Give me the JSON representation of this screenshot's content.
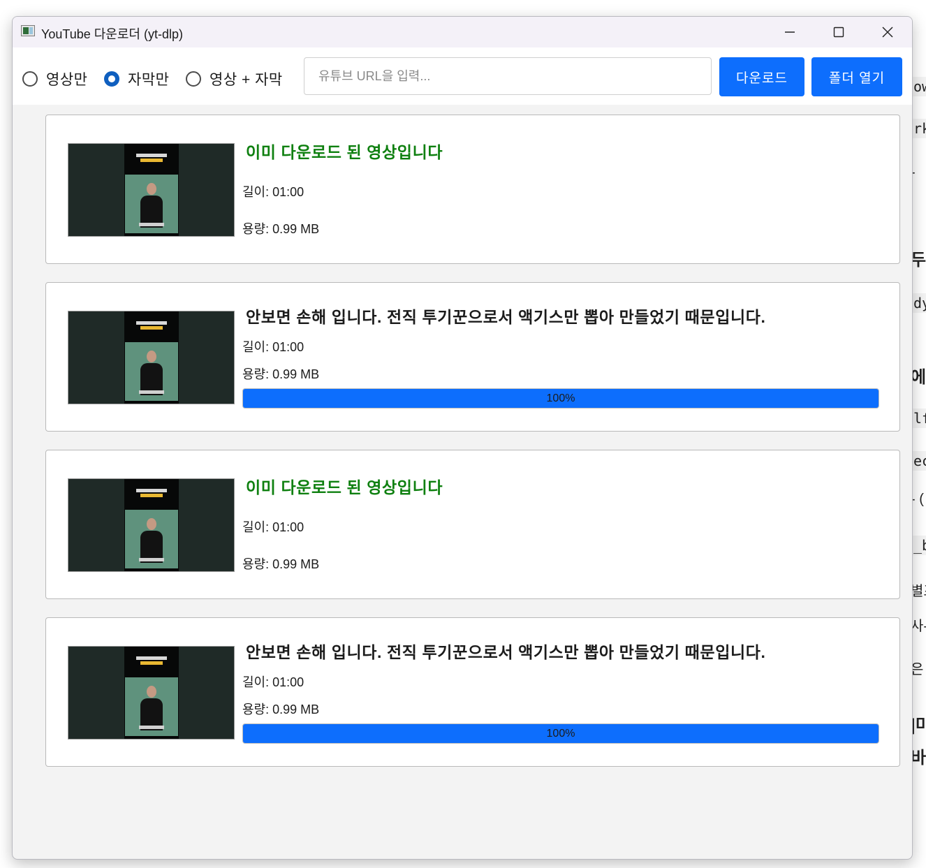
{
  "window": {
    "title": "YouTube 다운로더 (yt-dlp)"
  },
  "modes": [
    {
      "label": "영상만",
      "selected": false
    },
    {
      "label": "자막만",
      "selected": true
    },
    {
      "label": "영상 + 자막",
      "selected": false
    }
  ],
  "url_input": {
    "placeholder": "유튜브 URL을 입력...",
    "value": ""
  },
  "buttons": {
    "download": "다운로드",
    "open_folder": "폴더 열기"
  },
  "items": [
    {
      "title": "이미 다운로드 된 영상입니다",
      "status": "already_downloaded",
      "duration": "길이: 01:00",
      "size": "용량: 0.99 MB"
    },
    {
      "title": "안보면 손해 입니다. 전직 투기꾼으로서 액기스만 뽑아 만들었기 때문입니다.",
      "status": "completed",
      "duration": "길이: 01:00",
      "size": "용량: 0.99 MB",
      "progress": 100,
      "progress_label": "100%"
    },
    {
      "title": "이미 다운로드 된 영상입니다",
      "status": "already_downloaded",
      "duration": "길이: 01:00",
      "size": "용량: 0.99 MB"
    },
    {
      "title": "안보면 손해 입니다. 전직 투기꾼으로서 액기스만 뽑아 만들었기 때문입니다.",
      "status": "completed",
      "duration": "길이: 01:00",
      "size": "용량: 0.99 MB",
      "progress": 100,
      "progress_label": "100%"
    }
  ],
  "background_fragments": [
    "ow",
    "rk",
    "-",
    "두",
    "dy",
    "에",
    "lf",
    "ec",
    "- (",
    "_b",
    "별프",
    "사-",
    "은",
    "|미",
    "바르"
  ],
  "colors": {
    "accent": "#0d6efd",
    "done_text": "#0f8010",
    "radio_checked": "#0f5fbf"
  }
}
